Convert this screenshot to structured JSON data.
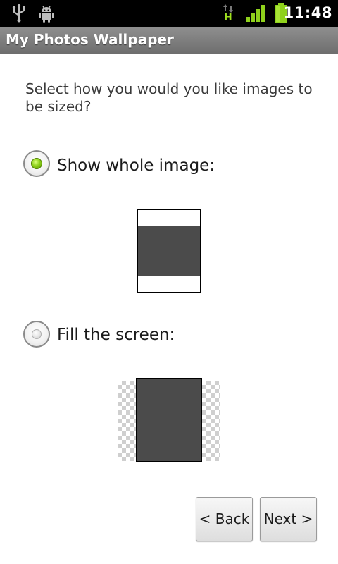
{
  "status_bar": {
    "icons": [
      "usb-icon",
      "android-debug-icon",
      "data-hspa-icon",
      "signal-icon",
      "battery-icon"
    ],
    "network_type": "H",
    "time": "11:48"
  },
  "title_bar": {
    "title": "My Photos Wallpaper"
  },
  "main": {
    "prompt": "Select how you would you like images to be sized?",
    "options": [
      {
        "label": "Show whole image:",
        "selected": true
      },
      {
        "label": "Fill the screen:",
        "selected": false
      }
    ]
  },
  "buttons": {
    "back": "< Back",
    "next": "Next >"
  },
  "colors": {
    "accent_green": "#8fd11c",
    "title_bar": "#7a7a7a",
    "preview_image": "#4b4b4b"
  }
}
